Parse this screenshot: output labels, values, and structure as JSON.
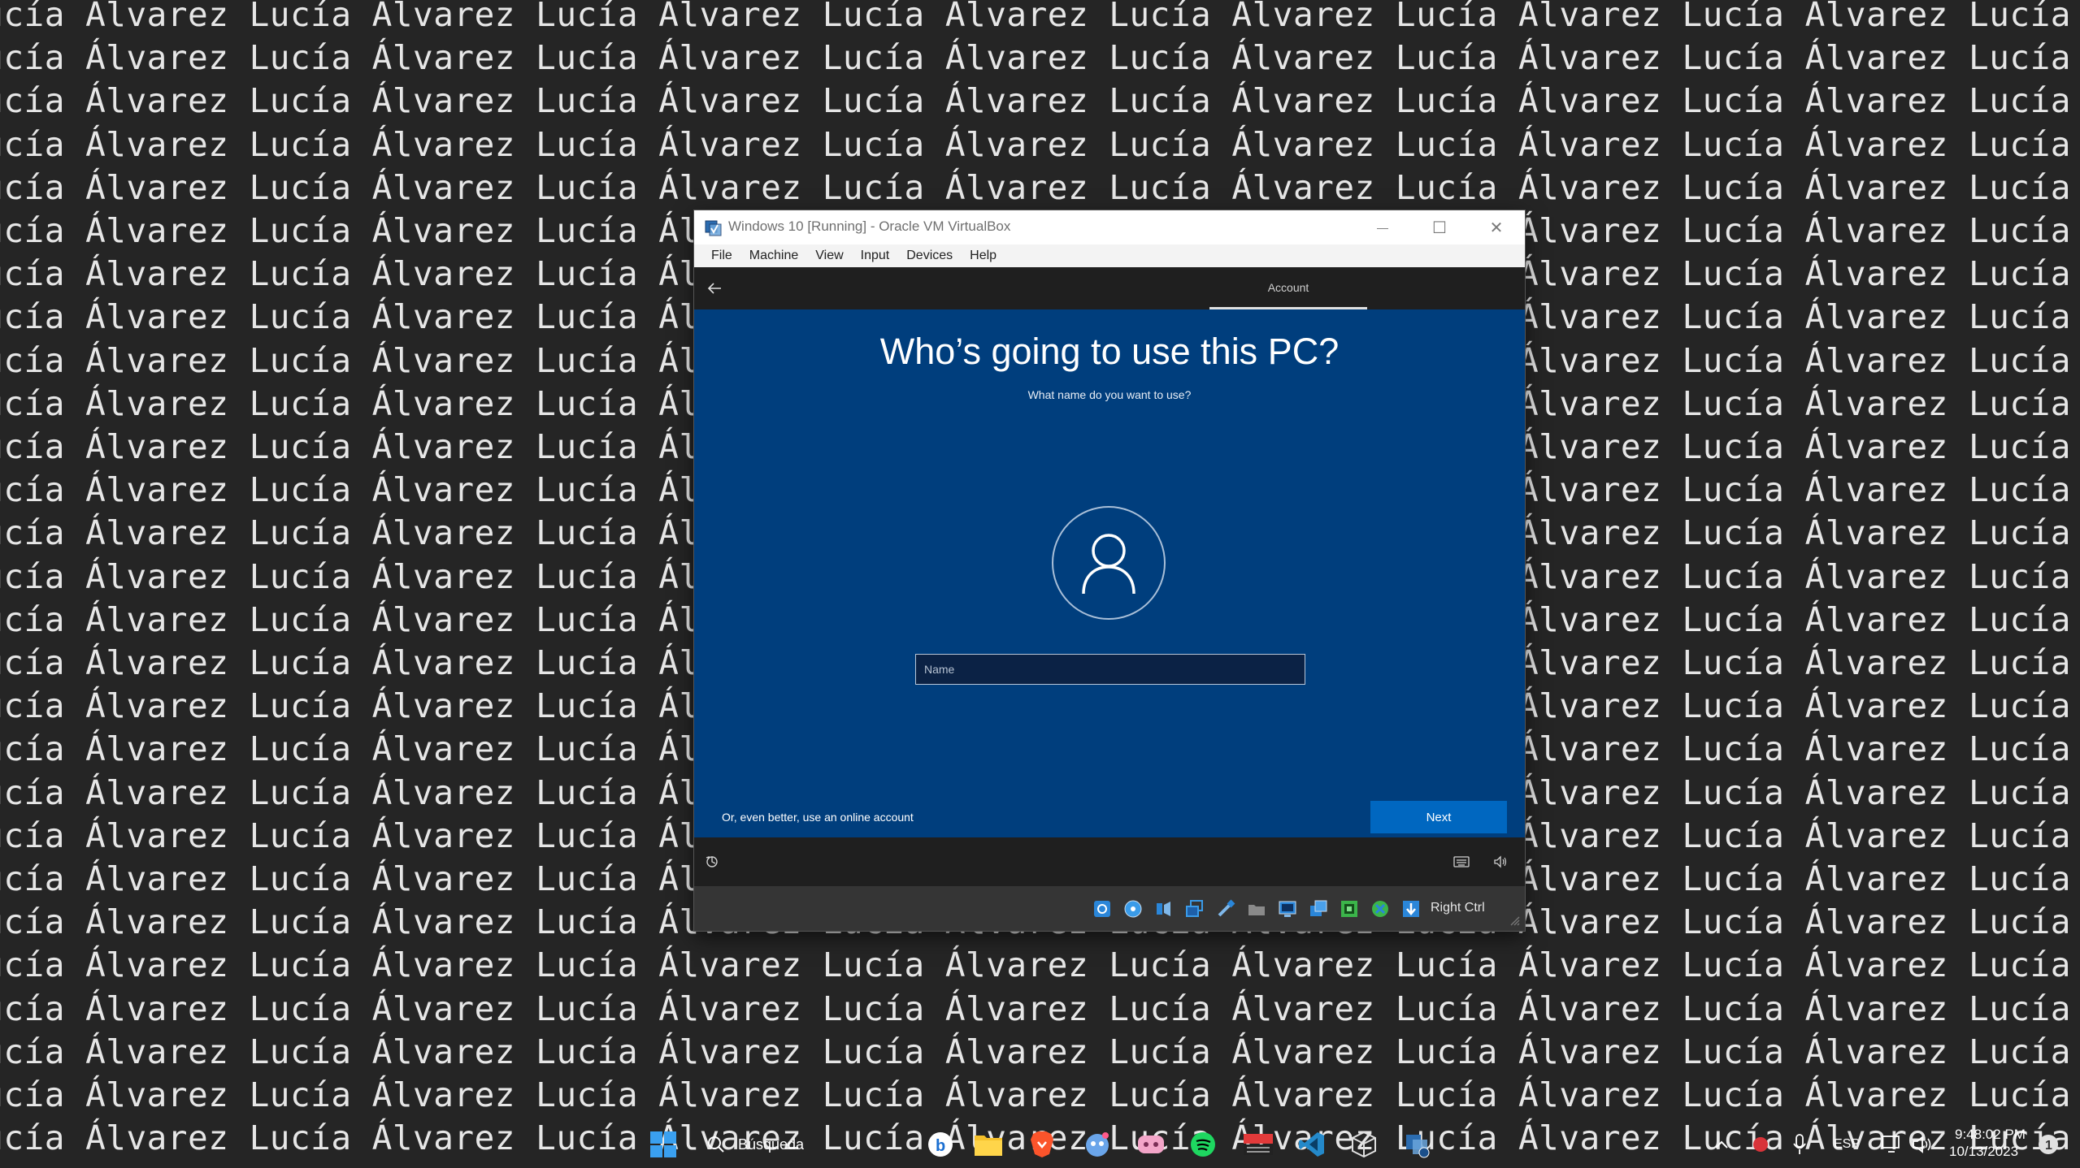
{
  "wallpaper": {
    "text": "Lucía Álvarez Lucía Álvarez Lucía Álvarez Lucía Álvarez Lucía Álvarez Lucía Álvarez Lucía Álvarez Lucía Álvarez Lucía Álvarez Lucía Álvarez Lucía Álvarez Lucía Álvarez Lucía Álvarez Lucía Álvarez Lucía Álvarez Lucía Álvarez"
  },
  "window": {
    "title": "Windows 10 [Running] - Oracle VM VirtualBox",
    "controls": {
      "minimize": "—",
      "maximize": "☐",
      "close": "✕"
    }
  },
  "menu": {
    "items": [
      "File",
      "Machine",
      "View",
      "Input",
      "Devices",
      "Help"
    ]
  },
  "oobe": {
    "step_label": "Account",
    "title": "Who’s going to use this PC?",
    "subtitle": "What name do you want to use?",
    "name_placeholder": "Name",
    "name_value": "",
    "online_link": "Or, even better, use an online account",
    "next_label": "Next"
  },
  "statusbar": {
    "host_key": "Right Ctrl"
  },
  "taskbar": {
    "search_label": "Búsqueda",
    "language": "ESP",
    "time": "9:48:02 PM",
    "date": "10/13/2023"
  },
  "colors": {
    "oobe_background": "#003e7d",
    "accent_button": "#0067c0",
    "wallpaper_text": "#e6e6e6",
    "wallpaper_background": "#252525"
  }
}
